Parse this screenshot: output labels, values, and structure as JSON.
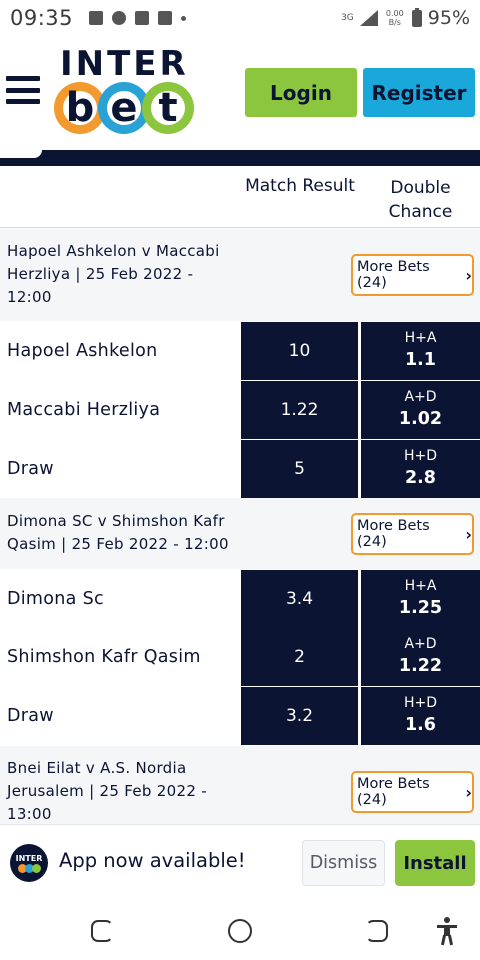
{
  "status_bar": {
    "time": "09:35",
    "network": "3G",
    "speed_value": "0.00",
    "speed_unit": "B/s",
    "battery": "95%",
    "icons": [
      "image-icon",
      "whatsapp-icon",
      "news-icon",
      "facebook-icon",
      "dot-icon"
    ]
  },
  "header": {
    "logo_top": "INTER",
    "logo_letters": [
      "b",
      "e",
      "t"
    ],
    "login_label": "Login",
    "register_label": "Register"
  },
  "columns": {
    "match_result": "Match Result",
    "double_chance_line1": "Double",
    "double_chance_line2": "Chance"
  },
  "matches": [
    {
      "title_lines": [
        "Hapoel Ashkelon v Maccabi",
        "Herzliya | 25 Feb 2022 -",
        "12:00"
      ],
      "more_bets": "More Bets (24)",
      "rows": [
        {
          "team": "Hapoel Ashkelon",
          "result": "10",
          "dc_label": "H+A",
          "dc_value": "1.1"
        },
        {
          "team": "Maccabi Herzliya",
          "result": "1.22",
          "dc_label": "A+D",
          "dc_value": "1.02"
        },
        {
          "team": "Draw",
          "result": "5",
          "dc_label": "H+D",
          "dc_value": "2.8"
        }
      ]
    },
    {
      "title_lines": [
        "Dimona SC v Shimshon Kafr",
        "Qasim | 25 Feb 2022 - 12:00"
      ],
      "more_bets": "More Bets (24)",
      "rows": [
        {
          "team": "Dimona Sc",
          "result": "3.4",
          "dc_label": "H+A",
          "dc_value": "1.25"
        },
        {
          "team": "Shimshon Kafr Qasim",
          "result": "2",
          "dc_label": "A+D",
          "dc_value": "1.22"
        },
        {
          "team": "Draw",
          "result": "3.2",
          "dc_label": "H+D",
          "dc_value": "1.6"
        }
      ]
    },
    {
      "title_lines": [
        "Bnei Eilat v A.S. Nordia",
        "Jerusalem | 25 Feb 2022 -",
        "13:00"
      ],
      "more_bets": "More Bets (24)"
    }
  ],
  "banner": {
    "icon_text": "INTER",
    "icon_letters": [
      "b",
      "e",
      "t"
    ],
    "message": "App now available!",
    "dismiss_label": "Dismiss",
    "install_label": "Install"
  },
  "colors": {
    "navy": "#0c1433",
    "green": "#8cc63f",
    "blue": "#19a8d9",
    "orange": "#f29a2e"
  },
  "nav_bar": {
    "icons": [
      "recent-apps-icon",
      "home-icon",
      "back-icon",
      "accessibility-icon"
    ]
  }
}
